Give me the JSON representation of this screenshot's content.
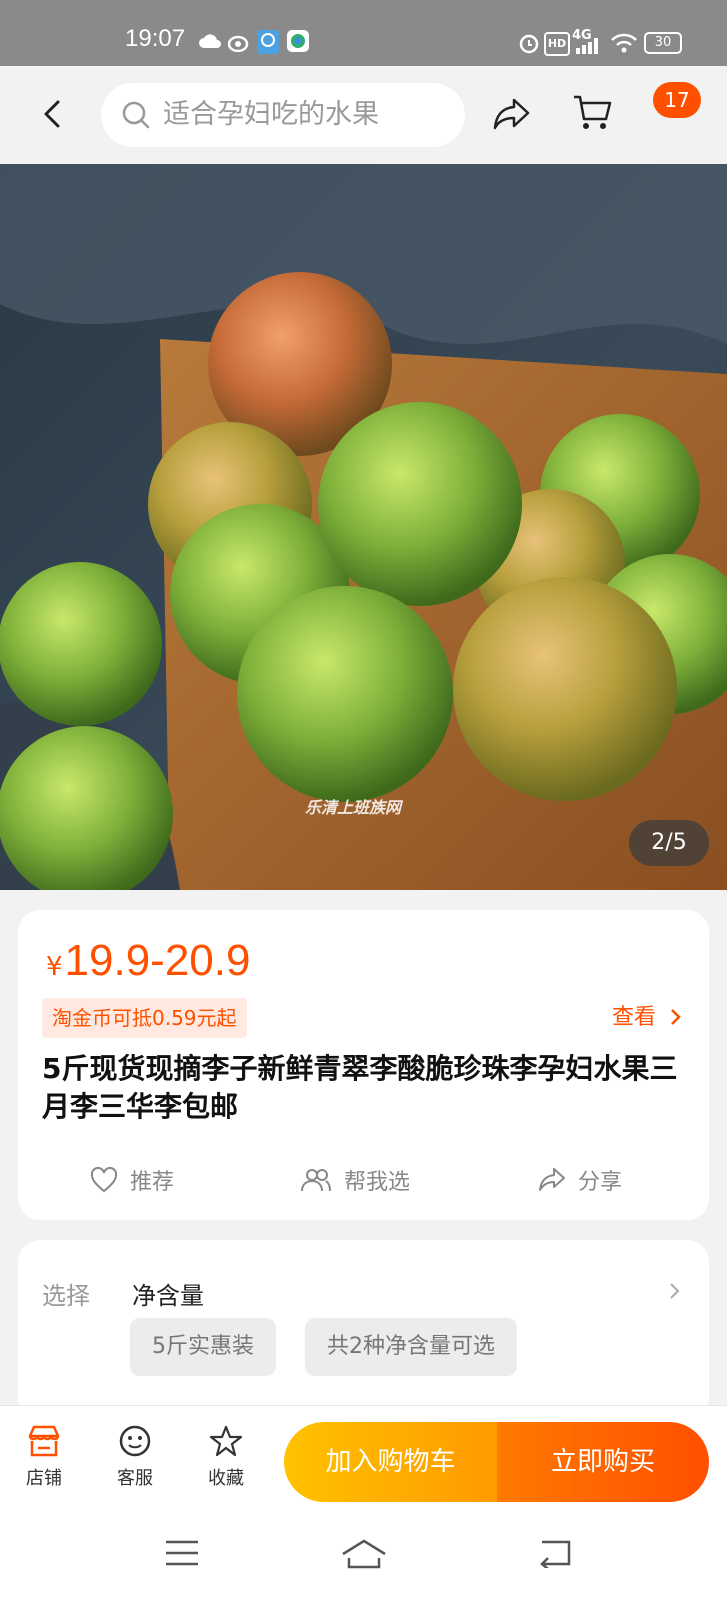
{
  "status_bar": {
    "time": "19:07",
    "network": "4G",
    "hd": "HD",
    "battery": "30",
    "icons": [
      "cloud-icon",
      "weibo-icon",
      "browser-icon",
      "app-icon",
      "alarm-icon",
      "hd-icon",
      "signal-icon",
      "wifi-icon",
      "battery-icon"
    ]
  },
  "header": {
    "search_placeholder": "适合孕妇吃的水果",
    "cart_badge": "17"
  },
  "gallery": {
    "indicator": "2/5",
    "watermark": "乐清上班族网"
  },
  "product": {
    "currency": "¥",
    "price": "19.9-20.9",
    "coin_tag": "淘金币可抵0.59元起",
    "view_link": "查看",
    "title": "5斤现货现摘李子新鲜青翠李酸脆珍珠李孕妇水果三月李三华李包邮",
    "actions": [
      {
        "label": "推荐",
        "icon": "heart-icon"
      },
      {
        "label": "帮我选",
        "icon": "people-icon"
      },
      {
        "label": "分享",
        "icon": "share-icon"
      }
    ]
  },
  "spec": {
    "label": "选择",
    "name": "净含量",
    "options": [
      "5斤实惠装",
      "共2种净含量可选"
    ]
  },
  "bottom_bar": {
    "tabs": [
      {
        "label": "店铺",
        "icon": "store-icon"
      },
      {
        "label": "客服",
        "icon": "service-icon"
      },
      {
        "label": "收藏",
        "icon": "star-icon"
      }
    ],
    "add_to_cart": "加入购物车",
    "buy_now": "立即购买"
  },
  "colors": {
    "accent": "#ff5000",
    "cart_button": "#ffb000",
    "buy_button": "#ff5a00"
  }
}
